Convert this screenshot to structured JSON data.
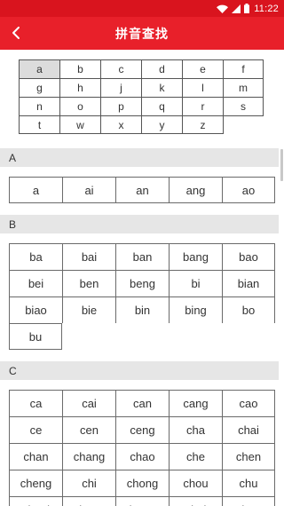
{
  "status_bar": {
    "time": "11:22",
    "wifi_icon": "wifi-icon",
    "signal_icon": "signal-icon",
    "battery_icon": "battery-icon"
  },
  "header": {
    "title": "拼音查找",
    "back_icon": "back-arrow-icon"
  },
  "index": {
    "letters": [
      "a",
      "b",
      "c",
      "d",
      "e",
      "f",
      "g",
      "h",
      "j",
      "k",
      "l",
      "m",
      "n",
      "o",
      "p",
      "q",
      "r",
      "s",
      "t",
      "w",
      "x",
      "y",
      "z"
    ],
    "selected": "a"
  },
  "sections": [
    {
      "letter": "A",
      "items": [
        "a",
        "ai",
        "an",
        "ang",
        "ao"
      ]
    },
    {
      "letter": "B",
      "items": [
        "ba",
        "bai",
        "ban",
        "bang",
        "bao",
        "bei",
        "ben",
        "beng",
        "bi",
        "bian",
        "biao",
        "bie",
        "bin",
        "bing",
        "bo",
        "bu"
      ]
    },
    {
      "letter": "C",
      "items": [
        "ca",
        "cai",
        "can",
        "cang",
        "cao",
        "ce",
        "cen",
        "ceng",
        "cha",
        "chai",
        "chan",
        "chang",
        "chao",
        "che",
        "chen",
        "cheng",
        "chi",
        "chong",
        "chou",
        "chu",
        "chuai",
        "chuan",
        "chuang",
        "chui",
        "chun"
      ]
    }
  ],
  "colors": {
    "status_bar": "#d9141e",
    "title_bar": "#e8202a",
    "section_header": "#e6e6e6",
    "selected_cell": "#dcdcdc"
  }
}
